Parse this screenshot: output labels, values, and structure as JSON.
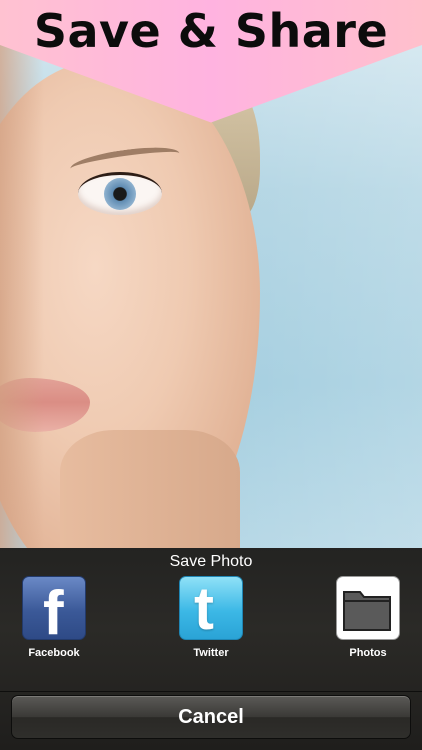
{
  "banner": {
    "title": "Save & Share"
  },
  "sheet": {
    "title": "Save Photo",
    "items": [
      {
        "label": "Facebook",
        "icon": "facebook-icon"
      },
      {
        "label": "Twitter",
        "icon": "twitter-icon"
      },
      {
        "label": "Photos",
        "icon": "folder-icon"
      }
    ],
    "cancel_label": "Cancel"
  },
  "colors": {
    "banner": "#ffb3e0",
    "facebook": "#3b5998",
    "twitter": "#3cb8e6",
    "sheet_bg": "#2b2a27"
  }
}
